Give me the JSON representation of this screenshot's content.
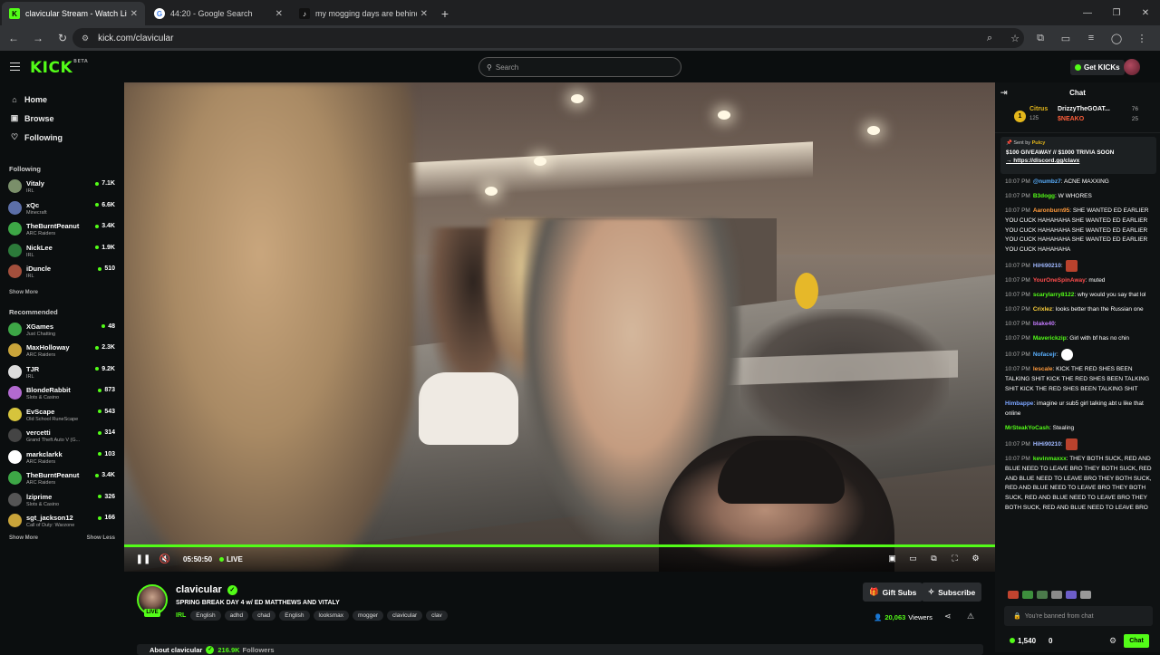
{
  "browser": {
    "tabs": [
      {
        "title": "clavicular Stream - Watch Live o",
        "fav": "K",
        "favcolor": "#53fc18",
        "favtext": "#000000"
      },
      {
        "title": "44:20 - Google Search",
        "fav": "G",
        "favcolor": "#ffffff",
        "favtext": "#4285f4"
      },
      {
        "title": "my mogging days are behind u",
        "fav": "♪",
        "favcolor": "#111111",
        "favtext": "#ffffff"
      }
    ],
    "url": "kick.com/clavicular"
  },
  "header": {
    "logo": "KICK",
    "logo_sup": "BETA",
    "search_placeholder": "Search",
    "get_kicks": "Get KICKs"
  },
  "sidebar": {
    "nav": [
      {
        "label": "Home",
        "icon": "⌂"
      },
      {
        "label": "Browse",
        "icon": "▣"
      },
      {
        "label": "Following",
        "icon": "♡"
      }
    ],
    "following_title": "Following",
    "following": [
      {
        "name": "Vitaly",
        "cat": "IRL",
        "viewers": "7.1K",
        "color": "#7a8f6a"
      },
      {
        "name": "xQc",
        "cat": "Minecraft",
        "viewers": "6.6K",
        "color": "#5c6fa8"
      },
      {
        "name": "TheBurntPeanut",
        "cat": "ARC Raiders",
        "viewers": "3.4K",
        "color": "#3da646"
      },
      {
        "name": "NickLee",
        "cat": "IRL",
        "viewers": "1.9K",
        "color": "#2c7a3a"
      },
      {
        "name": "iDuncle",
        "cat": "IRL",
        "viewers": "510",
        "color": "#a34f3c"
      }
    ],
    "show_more": "Show More",
    "recommended_title": "Recommended",
    "recommended": [
      {
        "name": "XGames",
        "cat": "Just Chatting",
        "viewers": "48",
        "color": "#3da646"
      },
      {
        "name": "MaxHolloway",
        "cat": "ARC Raiders",
        "viewers": "2.3K",
        "color": "#c9a43a"
      },
      {
        "name": "TJR",
        "cat": "IRL",
        "viewers": "9.2K",
        "color": "#dddddd"
      },
      {
        "name": "BlondeRabbit",
        "cat": "Slots & Casino",
        "viewers": "873",
        "color": "#b26ad0"
      },
      {
        "name": "EvScape",
        "cat": "Old School RuneScape",
        "viewers": "543",
        "color": "#d6c43c"
      },
      {
        "name": "vercetti",
        "cat": "Grand Theft Auto V (G...",
        "viewers": "314",
        "color": "#444444"
      },
      {
        "name": "markclarkk",
        "cat": "ARC Raiders",
        "viewers": "103",
        "color": "#ffffff"
      },
      {
        "name": "TheBurntPeanut",
        "cat": "ARC Raiders",
        "viewers": "3.4K",
        "color": "#3da646"
      },
      {
        "name": "lziprime",
        "cat": "Slots & Casino",
        "viewers": "326",
        "color": "#555555"
      },
      {
        "name": "sgt_jackson12",
        "cat": "Call of Duty: Warzone",
        "viewers": "166",
        "color": "#c9a43a"
      }
    ],
    "show_more2": "Show More",
    "show_less": "Show Less"
  },
  "player": {
    "time": "05:50:50",
    "live": "LIVE"
  },
  "stream": {
    "name": "clavicular",
    "title": "SPRING BREAK DAY 4 w/ ED MATTHEWS AND VITALY",
    "live_badge": "LIVE",
    "category": "IRL",
    "tags": [
      "English",
      "adhd",
      "chad",
      "English",
      "looksmax",
      "mogger",
      "clavicular",
      "clav"
    ],
    "gift_subs": "Gift Subs",
    "subscribe": "Subscribe",
    "viewers": "20,063",
    "viewers_label": "Viewers",
    "about_label": "About clavicular",
    "followers": "216.9K",
    "followers_label": "Followers"
  },
  "chat": {
    "title": "Chat",
    "gifters": {
      "rank": "1",
      "first_name": "Citrus",
      "first_count": "125",
      "second_name": "DrizzyTheGOAT...",
      "second_count": "76",
      "third_name": "$NEAKO",
      "third_count": "25"
    },
    "pinned": {
      "sent_by": "Sent by",
      "sender": "Pulcy",
      "message": "$100 GIVEAWAY // $1000 TRIVIA SOON",
      "link": "→ https://discord.gg/clavx"
    },
    "messages": [
      {
        "t": "10:07 PM",
        "u": "@numbz7",
        "c": "#5ab0ff",
        "m": ": ACNE MAXXING"
      },
      {
        "t": "10:07 PM",
        "u": "B3dogg",
        "c": "#53fc18",
        "m": ": W WHORES"
      },
      {
        "t": "10:07 PM",
        "u": "Aaronburn95",
        "c": "#ff9a3c",
        "m": ": SHE WANTED ED EARLIER YOU CUCK HAHAHAHA SHE WANTED ED EARLIER YOU CUCK HAHAHAHA SHE WANTED ED EARLIER YOU CUCK HAHAHAHA SHE WANTED ED EARLIER YOU CUCK HAHAHAHA"
      },
      {
        "t": "10:07 PM",
        "u": "HiHi90210",
        "c": "#a0b8ff",
        "m": ":"
      },
      {
        "t": "10:07 PM",
        "u": "YourOneSpinAway",
        "c": "#ff4d4d",
        "m": ": muted"
      },
      {
        "t": "10:07 PM",
        "u": "scarylarry8122",
        "c": "#53fc18",
        "m": ": why would you say that lol"
      },
      {
        "t": "10:07 PM",
        "u": "Crixlez",
        "c": "#ffd23c",
        "m": ": looks better than the Russian one"
      },
      {
        "t": "10:07 PM",
        "u": "blake40",
        "c": "#c57bff",
        "m": ":"
      },
      {
        "t": "10:07 PM",
        "u": "Maverickzip",
        "c": "#53fc18",
        "m": ": Girl with bf has no chin"
      },
      {
        "t": "10:07 PM",
        "u": "Nofacejr",
        "c": "#5ab0ff",
        "m": ":"
      },
      {
        "t": "10:07 PM",
        "u": "lescale",
        "c": "#ff9a3c",
        "m": ": KICK THE RED SHES BEEN TALKING SHIT KICK THE RED SHES BEEN TALKING SHIT KICK THE RED SHES BEEN TALKING SHIT"
      },
      {
        "t": "",
        "u": "Himbappe",
        "c": "#7ba4ff",
        "m": ": imagine ur sub5 girl talking abt u like that online"
      },
      {
        "t": "",
        "u": "MrSteakYoCash",
        "c": "#53fc18",
        "m": ": Stealing"
      },
      {
        "t": "10:07 PM",
        "u": "HiHi90210",
        "c": "#a0b8ff",
        "m": ":"
      },
      {
        "t": "10:07 PM",
        "u": "kevinmaxxx",
        "c": "#53fc18",
        "m": ": THEY BOTH SUCK, RED AND BLUE NEED TO LEAVE BRO THEY BOTH SUCK, RED AND BLUE NEED TO LEAVE BRO THEY BOTH SUCK, RED AND BLUE NEED TO LEAVE BRO THEY BOTH SUCK, RED AND BLUE NEED TO LEAVE BRO THEY BOTH SUCK, RED AND BLUE NEED TO LEAVE BRO"
      }
    ],
    "input_placeholder": "You're banned from chat",
    "kicks": "1,540",
    "count": "0",
    "chat_button": "Chat"
  }
}
